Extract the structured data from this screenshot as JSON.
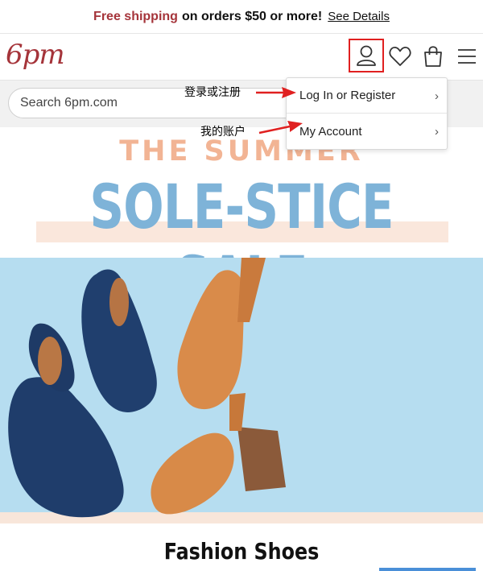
{
  "promo": {
    "highlight": "Free shipping",
    "text": "on orders $50 or more!",
    "link": "See Details"
  },
  "header": {
    "logo": "6pm",
    "icons": [
      "account-icon",
      "heart-icon",
      "bag-icon",
      "menu-icon"
    ]
  },
  "search": {
    "placeholder": "Search 6pm.com"
  },
  "account_menu": {
    "items": [
      {
        "label": "Log In or Register"
      },
      {
        "label": "My Account"
      }
    ]
  },
  "annotations": {
    "login": "登录或注册",
    "account": "我的账户"
  },
  "banner": {
    "line1": "THE SUMMER",
    "line2": "SOLE-STICE SALE"
  },
  "section": {
    "title": "Fashion Shoes"
  },
  "colors": {
    "brand": "#a5343a",
    "annotation_red": "#e02020",
    "banner_peach": "#f2b494",
    "banner_blue": "#7eb3d8",
    "photo_bg": "#b5ddf0"
  }
}
